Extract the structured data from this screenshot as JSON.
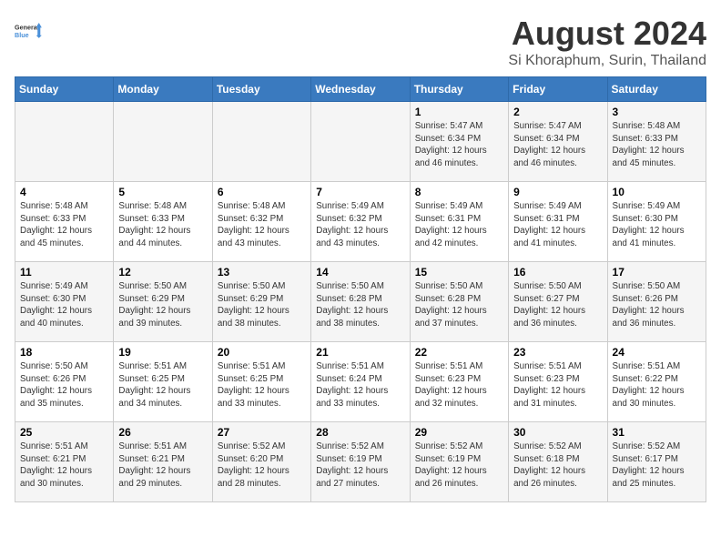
{
  "header": {
    "logo_line1": "General",
    "logo_line2": "Blue",
    "main_title": "August 2024",
    "sub_title": "Si Khoraphum, Surin, Thailand"
  },
  "weekdays": [
    "Sunday",
    "Monday",
    "Tuesday",
    "Wednesday",
    "Thursday",
    "Friday",
    "Saturday"
  ],
  "weeks": [
    [
      {
        "day": "",
        "info": ""
      },
      {
        "day": "",
        "info": ""
      },
      {
        "day": "",
        "info": ""
      },
      {
        "day": "",
        "info": ""
      },
      {
        "day": "1",
        "info": "Sunrise: 5:47 AM\nSunset: 6:34 PM\nDaylight: 12 hours\nand 46 minutes."
      },
      {
        "day": "2",
        "info": "Sunrise: 5:47 AM\nSunset: 6:34 PM\nDaylight: 12 hours\nand 46 minutes."
      },
      {
        "day": "3",
        "info": "Sunrise: 5:48 AM\nSunset: 6:33 PM\nDaylight: 12 hours\nand 45 minutes."
      }
    ],
    [
      {
        "day": "4",
        "info": "Sunrise: 5:48 AM\nSunset: 6:33 PM\nDaylight: 12 hours\nand 45 minutes."
      },
      {
        "day": "5",
        "info": "Sunrise: 5:48 AM\nSunset: 6:33 PM\nDaylight: 12 hours\nand 44 minutes."
      },
      {
        "day": "6",
        "info": "Sunrise: 5:48 AM\nSunset: 6:32 PM\nDaylight: 12 hours\nand 43 minutes."
      },
      {
        "day": "7",
        "info": "Sunrise: 5:49 AM\nSunset: 6:32 PM\nDaylight: 12 hours\nand 43 minutes."
      },
      {
        "day": "8",
        "info": "Sunrise: 5:49 AM\nSunset: 6:31 PM\nDaylight: 12 hours\nand 42 minutes."
      },
      {
        "day": "9",
        "info": "Sunrise: 5:49 AM\nSunset: 6:31 PM\nDaylight: 12 hours\nand 41 minutes."
      },
      {
        "day": "10",
        "info": "Sunrise: 5:49 AM\nSunset: 6:30 PM\nDaylight: 12 hours\nand 41 minutes."
      }
    ],
    [
      {
        "day": "11",
        "info": "Sunrise: 5:49 AM\nSunset: 6:30 PM\nDaylight: 12 hours\nand 40 minutes."
      },
      {
        "day": "12",
        "info": "Sunrise: 5:50 AM\nSunset: 6:29 PM\nDaylight: 12 hours\nand 39 minutes."
      },
      {
        "day": "13",
        "info": "Sunrise: 5:50 AM\nSunset: 6:29 PM\nDaylight: 12 hours\nand 38 minutes."
      },
      {
        "day": "14",
        "info": "Sunrise: 5:50 AM\nSunset: 6:28 PM\nDaylight: 12 hours\nand 38 minutes."
      },
      {
        "day": "15",
        "info": "Sunrise: 5:50 AM\nSunset: 6:28 PM\nDaylight: 12 hours\nand 37 minutes."
      },
      {
        "day": "16",
        "info": "Sunrise: 5:50 AM\nSunset: 6:27 PM\nDaylight: 12 hours\nand 36 minutes."
      },
      {
        "day": "17",
        "info": "Sunrise: 5:50 AM\nSunset: 6:26 PM\nDaylight: 12 hours\nand 36 minutes."
      }
    ],
    [
      {
        "day": "18",
        "info": "Sunrise: 5:50 AM\nSunset: 6:26 PM\nDaylight: 12 hours\nand 35 minutes."
      },
      {
        "day": "19",
        "info": "Sunrise: 5:51 AM\nSunset: 6:25 PM\nDaylight: 12 hours\nand 34 minutes."
      },
      {
        "day": "20",
        "info": "Sunrise: 5:51 AM\nSunset: 6:25 PM\nDaylight: 12 hours\nand 33 minutes."
      },
      {
        "day": "21",
        "info": "Sunrise: 5:51 AM\nSunset: 6:24 PM\nDaylight: 12 hours\nand 33 minutes."
      },
      {
        "day": "22",
        "info": "Sunrise: 5:51 AM\nSunset: 6:23 PM\nDaylight: 12 hours\nand 32 minutes."
      },
      {
        "day": "23",
        "info": "Sunrise: 5:51 AM\nSunset: 6:23 PM\nDaylight: 12 hours\nand 31 minutes."
      },
      {
        "day": "24",
        "info": "Sunrise: 5:51 AM\nSunset: 6:22 PM\nDaylight: 12 hours\nand 30 minutes."
      }
    ],
    [
      {
        "day": "25",
        "info": "Sunrise: 5:51 AM\nSunset: 6:21 PM\nDaylight: 12 hours\nand 30 minutes."
      },
      {
        "day": "26",
        "info": "Sunrise: 5:51 AM\nSunset: 6:21 PM\nDaylight: 12 hours\nand 29 minutes."
      },
      {
        "day": "27",
        "info": "Sunrise: 5:52 AM\nSunset: 6:20 PM\nDaylight: 12 hours\nand 28 minutes."
      },
      {
        "day": "28",
        "info": "Sunrise: 5:52 AM\nSunset: 6:19 PM\nDaylight: 12 hours\nand 27 minutes."
      },
      {
        "day": "29",
        "info": "Sunrise: 5:52 AM\nSunset: 6:19 PM\nDaylight: 12 hours\nand 26 minutes."
      },
      {
        "day": "30",
        "info": "Sunrise: 5:52 AM\nSunset: 6:18 PM\nDaylight: 12 hours\nand 26 minutes."
      },
      {
        "day": "31",
        "info": "Sunrise: 5:52 AM\nSunset: 6:17 PM\nDaylight: 12 hours\nand 25 minutes."
      }
    ]
  ]
}
